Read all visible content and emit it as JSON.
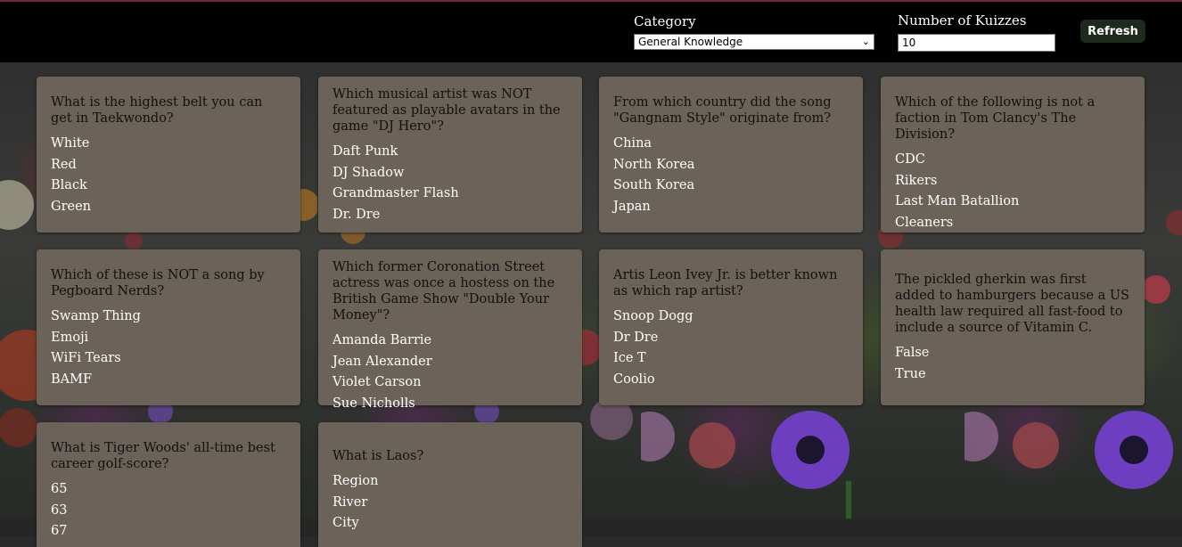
{
  "header": {
    "category_label": "Category",
    "category_value": "General Knowledge",
    "count_label": "Number of Kuizzes",
    "count_value": "10",
    "refresh_label": "Refresh"
  },
  "cards": [
    {
      "question": "What is the highest belt you can get in Taekwondo?",
      "answers": [
        "White",
        "Red",
        "Black",
        "Green"
      ]
    },
    {
      "question": "Which musical artist was NOT featured as playable avatars in the game \"DJ Hero\"?",
      "answers": [
        "Daft Punk",
        "DJ Shadow",
        "Grandmaster Flash",
        "Dr. Dre"
      ]
    },
    {
      "question": "From which country did the song \"Gangnam Style\" originate from?",
      "answers": [
        "China",
        "North Korea",
        "South Korea",
        "Japan"
      ]
    },
    {
      "question": "Which of the following is not a faction in Tom Clancy's The Division?",
      "answers": [
        "CDC",
        "Rikers",
        "Last Man Batallion",
        "Cleaners"
      ]
    },
    {
      "question": "Which of these is NOT a song by Pegboard Nerds?",
      "answers": [
        "Swamp Thing",
        "Emoji",
        "WiFi Tears",
        "BAMF"
      ]
    },
    {
      "question": "Which former Coronation Street actress was once a hostess on the British Game Show \"Double Your Money\"?",
      "answers": [
        "Amanda Barrie",
        "Jean Alexander",
        "Violet Carson",
        "Sue Nicholls"
      ]
    },
    {
      "question": "Artis Leon Ivey Jr. is better known as which rap artist?",
      "answers": [
        "Snoop Dogg",
        "Dr Dre",
        "Ice T",
        "Coolio"
      ]
    },
    {
      "question": "The pickled gherkin was first added to hamburgers because a US health law required all fast-food to include a source of Vitamin C.",
      "answers": [
        "False",
        "True"
      ]
    },
    {
      "question": "What is Tiger Woods' all-time best career golf-score?",
      "answers": [
        "65",
        "63",
        "67"
      ]
    },
    {
      "question": "What is Laos?",
      "answers": [
        "Region",
        "River",
        "City"
      ]
    }
  ]
}
